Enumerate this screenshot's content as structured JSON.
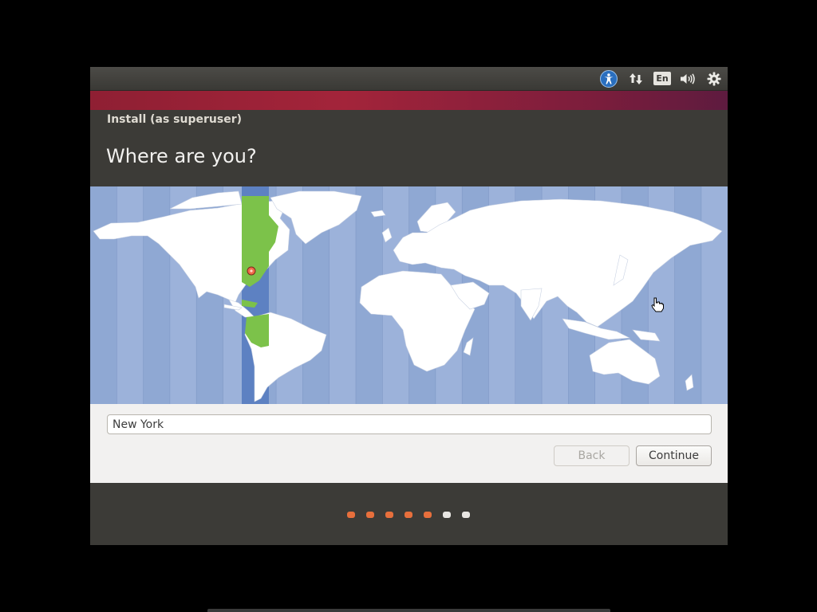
{
  "panel": {
    "icons": [
      "accessibility-icon",
      "network-icon",
      "keyboard-layout-icon",
      "sound-icon",
      "gear-icon"
    ],
    "keyboard_layout": "En"
  },
  "window": {
    "title": "Install (as superuser)",
    "heading": "Where are you?"
  },
  "timezone_map": {
    "selected_zone_color": "#7cc24a",
    "selected_band_color": "#5d81c2",
    "ocean_color": "#8fa8d3",
    "land_color": "#ffffff",
    "pin_color": "#f06a4a"
  },
  "location": {
    "value": "New York"
  },
  "buttons": {
    "back_label": "Back",
    "back_enabled": false,
    "continue_label": "Continue"
  },
  "progress": {
    "total_steps": 7,
    "completed_steps": 5,
    "completed_color": "#e76f3c",
    "pending_color": "#e8e6e2"
  }
}
